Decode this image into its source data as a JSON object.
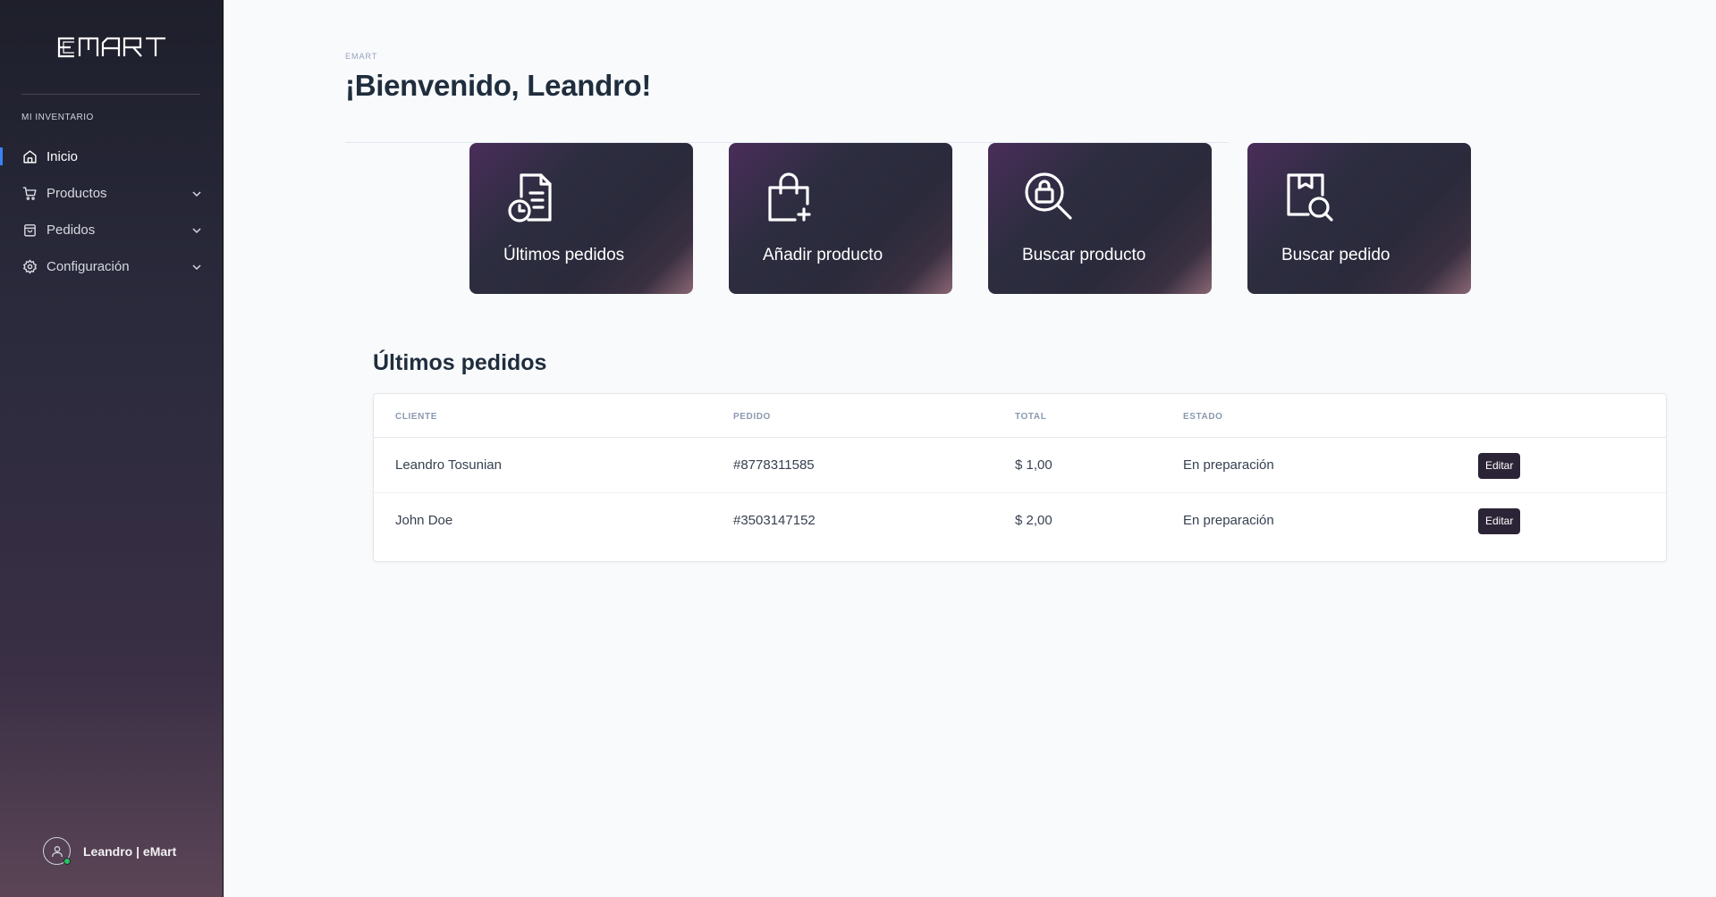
{
  "app": {
    "logo_text": "EMART"
  },
  "sidebar": {
    "section_label": "MI INVENTARIO",
    "items": [
      {
        "label": "Inicio",
        "icon": "home-icon",
        "active": true,
        "expandable": false
      },
      {
        "label": "Productos",
        "icon": "cart-icon",
        "active": false,
        "expandable": true
      },
      {
        "label": "Pedidos",
        "icon": "shopping-bag-icon",
        "active": false,
        "expandable": true
      },
      {
        "label": "Configuración",
        "icon": "gear-icon",
        "active": false,
        "expandable": true
      }
    ],
    "user": {
      "name": "Leandro | eMart",
      "status": "online"
    }
  },
  "header": {
    "breadcrumb": "EMART",
    "title": "¡Bienvenido, Leandro!"
  },
  "quick_actions": [
    {
      "label": "Últimos pedidos",
      "icon": "document-clock-icon"
    },
    {
      "label": "Añadir producto",
      "icon": "bag-add-icon"
    },
    {
      "label": "Buscar producto",
      "icon": "search-bag-icon"
    },
    {
      "label": "Buscar pedido",
      "icon": "package-search-icon"
    }
  ],
  "orders": {
    "title": "Últimos pedidos",
    "columns": [
      "CLIENTE",
      "PEDIDO",
      "TOTAL",
      "ESTADO"
    ],
    "rows": [
      {
        "cliente": "Leandro Tosunian",
        "pedido": "#8778311585",
        "total": "$ 1,00",
        "estado": "En preparación",
        "action": "Editar"
      },
      {
        "cliente": "John Doe",
        "pedido": "#3503147152",
        "total": "$ 2,00",
        "estado": "En preparación",
        "action": "Editar"
      }
    ]
  },
  "colors": {
    "sidebar_top": "#1e1f2b",
    "sidebar_bottom": "#5b4556",
    "active_indicator": "#3b82f6",
    "online": "#22c55e",
    "card_base": "#2a2a3b",
    "button_bg": "#2b2436"
  }
}
